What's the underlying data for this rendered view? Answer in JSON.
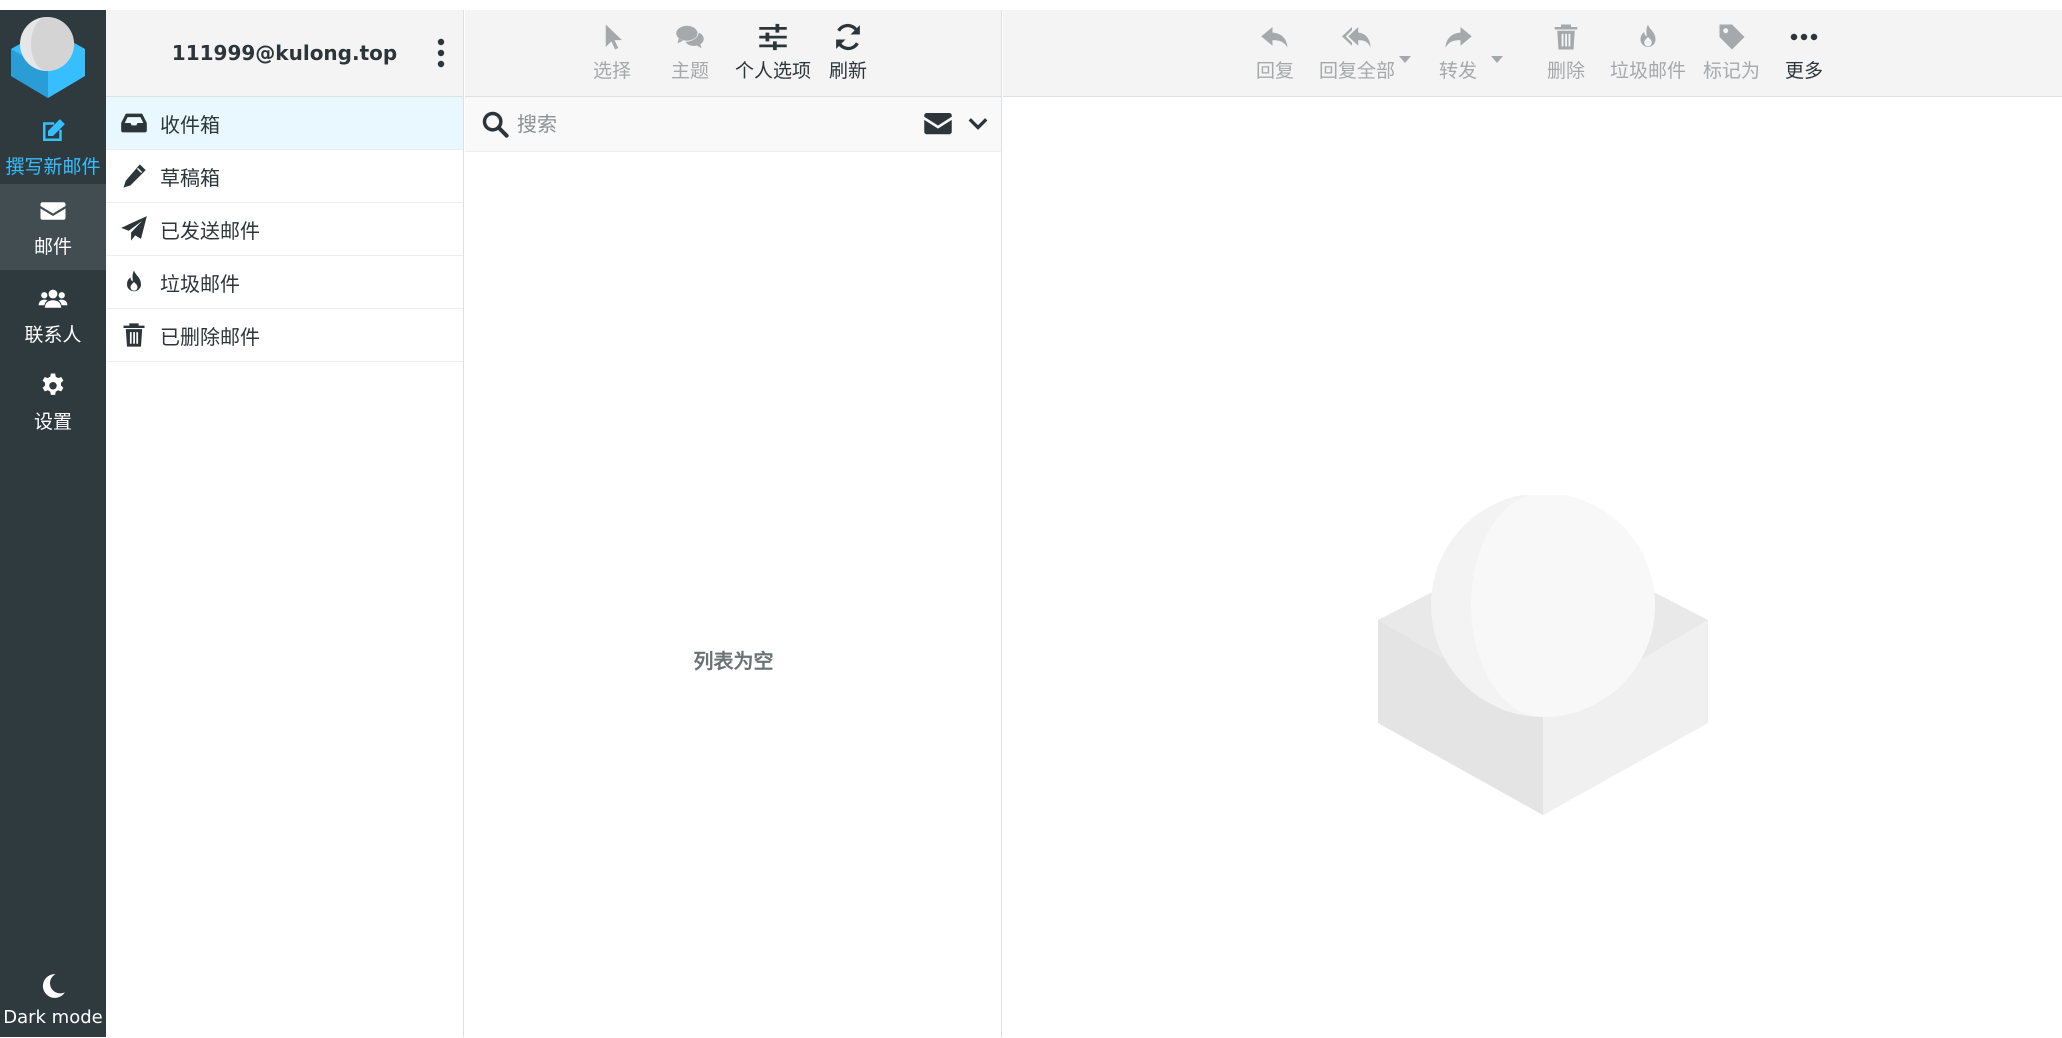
{
  "nav": {
    "compose": "撰写新邮件",
    "mail": "邮件",
    "contacts": "联系人",
    "settings": "设置",
    "dark_mode": "Dark mode"
  },
  "account": {
    "email": "111999@kulong.top"
  },
  "folders": [
    {
      "label": "收件箱",
      "icon": "inbox-icon",
      "active": true
    },
    {
      "label": "草稿箱",
      "icon": "pencil-icon",
      "active": false
    },
    {
      "label": "已发送邮件",
      "icon": "paper-plane-icon",
      "active": false
    },
    {
      "label": "垃圾邮件",
      "icon": "fire-icon",
      "active": false
    },
    {
      "label": "已删除邮件",
      "icon": "trash-icon",
      "active": false
    }
  ],
  "list_toolbar": {
    "select": "选择",
    "threads": "主题",
    "options": "个人选项",
    "refresh": "刷新"
  },
  "search": {
    "placeholder": "搜索"
  },
  "list": {
    "empty_text": "列表为空"
  },
  "message_toolbar": {
    "reply": "回复",
    "reply_all": "回复全部",
    "forward": "转发",
    "delete": "删除",
    "junk": "垃圾邮件",
    "mark": "标记为",
    "more": "更多"
  },
  "colors": {
    "nav_bg": "#2f3a3f",
    "accent": "#37beff",
    "active_folder_bg": "#e9f8ff"
  }
}
